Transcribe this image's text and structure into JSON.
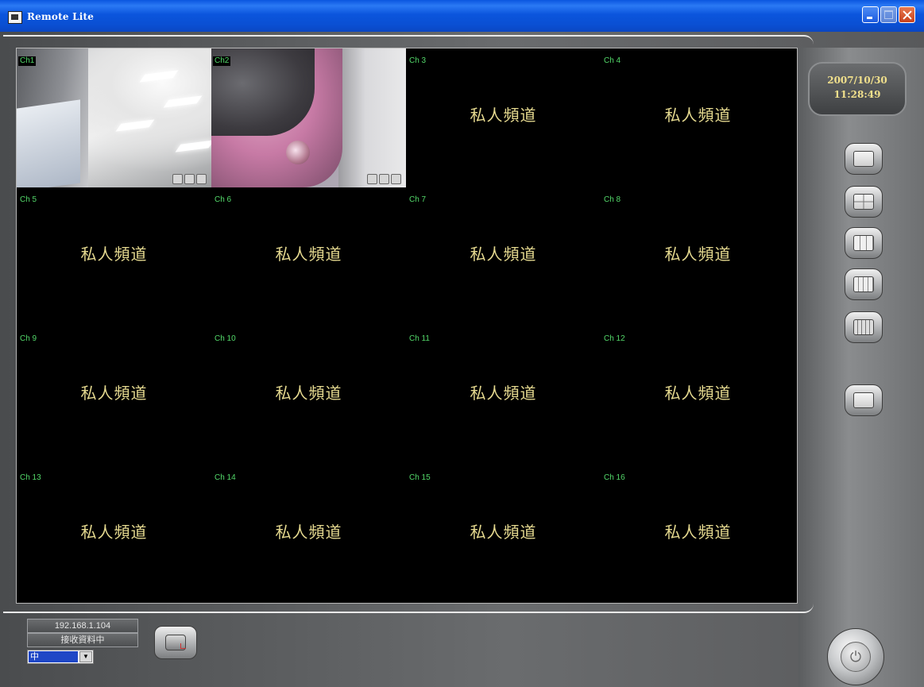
{
  "window": {
    "title": "Remote Lite"
  },
  "datetime": {
    "date": "2007/10/30",
    "time": "11:28:49"
  },
  "channels": [
    {
      "label": "Ch1",
      "text": ""
    },
    {
      "label": "Ch2",
      "text": ""
    },
    {
      "label": "Ch 3",
      "text": "私人頻道"
    },
    {
      "label": "Ch 4",
      "text": "私人頻道"
    },
    {
      "label": "Ch 5",
      "text": "私人頻道"
    },
    {
      "label": "Ch 6",
      "text": "私人頻道"
    },
    {
      "label": "Ch 7",
      "text": "私人頻道"
    },
    {
      "label": "Ch 8",
      "text": "私人頻道"
    },
    {
      "label": "Ch 9",
      "text": "私人頻道"
    },
    {
      "label": "Ch 10",
      "text": "私人頻道"
    },
    {
      "label": "Ch 11",
      "text": "私人頻道"
    },
    {
      "label": "Ch 12",
      "text": "私人頻道"
    },
    {
      "label": "Ch 13",
      "text": "私人頻道"
    },
    {
      "label": "Ch 14",
      "text": "私人頻道"
    },
    {
      "label": "Ch 15",
      "text": "私人頻道"
    },
    {
      "label": "Ch 16",
      "text": "私人頻道"
    }
  ],
  "status": {
    "ip": "192.168.1.104",
    "receiving": "接收資料中",
    "quality_selected": "中"
  },
  "icons": {
    "layout_buttons": [
      "layout-1-icon",
      "layout-4-icon",
      "layout-9-icon",
      "layout-13-icon",
      "layout-16-icon",
      "fullscreen-icon"
    ],
    "connect": "camera-connect-icon",
    "power": "power-icon"
  },
  "colors": {
    "channel_label": "#53d96a",
    "private_text": "#e5d98f",
    "datetime_text": "#f1e08c",
    "titlebar": "#0a56e0"
  }
}
